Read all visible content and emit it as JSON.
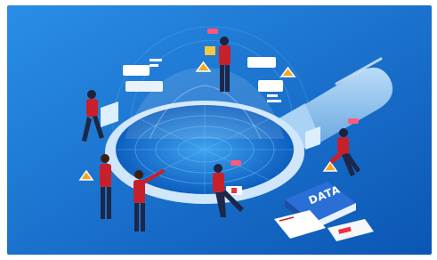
{
  "illustration": {
    "subject": "people-analyzing-data-magnifying-glass",
    "book_label": "DATA",
    "colors": {
      "background_light": "#2a8ee6",
      "background_dark": "#0b56b3",
      "glass_frame": "#dfeefc",
      "handle": "#8fc3ef",
      "shirt": "#c8202a",
      "trousers": "#1d2747",
      "accent_orange": "#f5a623"
    }
  }
}
